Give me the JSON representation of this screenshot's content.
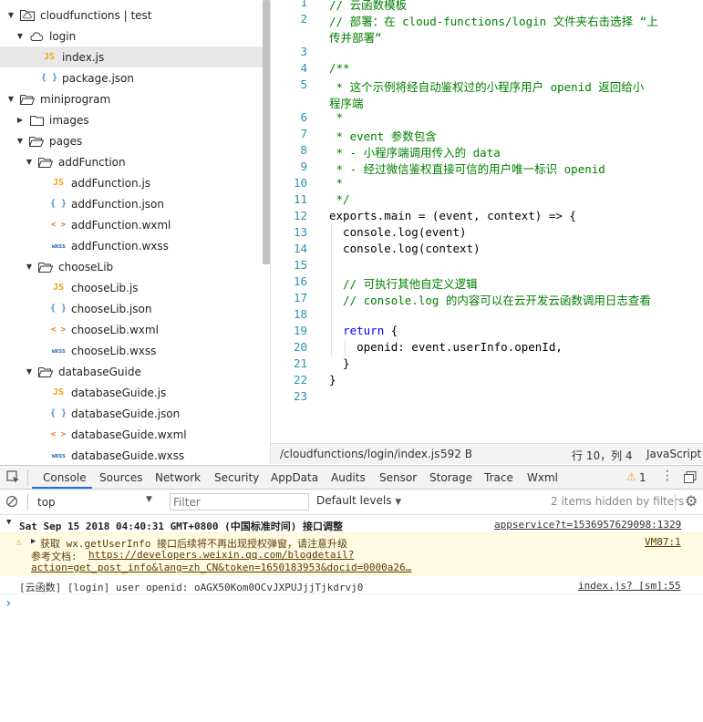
{
  "sidebar": {
    "items": [
      {
        "label": "cloudfunctions | test",
        "level": 0,
        "caret": "down",
        "icon": "cloud-folder-icon"
      },
      {
        "label": "login",
        "level": 1,
        "caret": "down",
        "icon": "cloud-icon"
      },
      {
        "label": "index.js",
        "level": 2,
        "caret": "",
        "icon": "js-file-icon",
        "selected": true
      },
      {
        "label": "package.json",
        "level": 2,
        "caret": "",
        "icon": "json-file-icon"
      },
      {
        "label": "miniprogram",
        "level": 0,
        "caret": "down",
        "icon": "folder-open-icon"
      },
      {
        "label": "images",
        "level": 1,
        "caret": "right",
        "icon": "folder-icon"
      },
      {
        "label": "pages",
        "level": 1,
        "caret": "down",
        "icon": "folder-open-icon"
      },
      {
        "label": "addFunction",
        "level": 2,
        "caret": "down",
        "icon": "folder-open-icon"
      },
      {
        "label": "addFunction.js",
        "level": 3,
        "caret": "",
        "icon": "js-file-icon"
      },
      {
        "label": "addFunction.json",
        "level": 3,
        "caret": "",
        "icon": "json-file-icon"
      },
      {
        "label": "addFunction.wxml",
        "level": 3,
        "caret": "",
        "icon": "wxml-file-icon"
      },
      {
        "label": "addFunction.wxss",
        "level": 3,
        "caret": "",
        "icon": "wxss-file-icon"
      },
      {
        "label": "chooseLib",
        "level": 2,
        "caret": "down",
        "icon": "folder-open-icon"
      },
      {
        "label": "chooseLib.js",
        "level": 3,
        "caret": "",
        "icon": "js-file-icon"
      },
      {
        "label": "chooseLib.json",
        "level": 3,
        "caret": "",
        "icon": "json-file-icon"
      },
      {
        "label": "chooseLib.wxml",
        "level": 3,
        "caret": "",
        "icon": "wxml-file-icon"
      },
      {
        "label": "chooseLib.wxss",
        "level": 3,
        "caret": "",
        "icon": "wxss-file-icon"
      },
      {
        "label": "databaseGuide",
        "level": 2,
        "caret": "down",
        "icon": "folder-open-icon"
      },
      {
        "label": "databaseGuide.js",
        "level": 3,
        "caret": "",
        "icon": "js-file-icon"
      },
      {
        "label": "databaseGuide.json",
        "level": 3,
        "caret": "",
        "icon": "json-file-icon"
      },
      {
        "label": "databaseGuide.wxml",
        "level": 3,
        "caret": "",
        "icon": "wxml-file-icon"
      },
      {
        "label": "databaseGuide.wxss",
        "level": 3,
        "caret": "",
        "icon": "wxss-file-icon"
      }
    ],
    "icon_glyphs": {
      "js": "JS",
      "json": "{ }",
      "wxml": "< >",
      "wxss": "wxss"
    }
  },
  "editor": {
    "lines": [
      {
        "n": "1",
        "text": "// 云函数模板",
        "cls": "c"
      },
      {
        "n": "2",
        "text": "// 部署：在 cloud-functions/login 文件夹右击选择 “上",
        "cls": "c"
      },
      {
        "n": "",
        "text": "传并部署”",
        "cls": "c",
        "wrap": true
      },
      {
        "n": "3",
        "text": "",
        "cls": ""
      },
      {
        "n": "4",
        "text": "/**",
        "cls": "c"
      },
      {
        "n": "5",
        "text": " * 这个示例将经自动鉴权过的小程序用户 openid 返回给小",
        "cls": "c"
      },
      {
        "n": "",
        "text": "程序端",
        "cls": "c",
        "wrap": true
      },
      {
        "n": "6",
        "text": " *",
        "cls": "c"
      },
      {
        "n": "7",
        "text": " * event 参数包含",
        "cls": "c"
      },
      {
        "n": "8",
        "text": " * - 小程序端调用传入的 data",
        "cls": "c"
      },
      {
        "n": "9",
        "text": " * - 经过微信鉴权直接可信的用户唯一标识 openid",
        "cls": "c"
      },
      {
        "n": "10",
        "text": " *",
        "cls": "c"
      },
      {
        "n": "11",
        "text": " */",
        "cls": "c"
      },
      {
        "n": "12",
        "text": "exports.main = (event, context) => {",
        "cls": ""
      },
      {
        "n": "13",
        "text": "  console.log(event)",
        "cls": ""
      },
      {
        "n": "14",
        "text": "  console.log(context)",
        "cls": ""
      },
      {
        "n": "15",
        "text": "",
        "cls": ""
      },
      {
        "n": "16",
        "text": "  // 可执行其他自定义逻辑",
        "cls": "c"
      },
      {
        "n": "17",
        "text": "  // console.log 的内容可以在云开发云函数调用日志查看",
        "cls": "c"
      },
      {
        "n": "18",
        "text": "",
        "cls": ""
      },
      {
        "n": "19",
        "text": "  return {",
        "cls": "kw"
      },
      {
        "n": "20",
        "text": "    openid: event.userInfo.openId,",
        "cls": ""
      },
      {
        "n": "21",
        "text": "  }",
        "cls": ""
      },
      {
        "n": "22",
        "text": "}",
        "cls": ""
      },
      {
        "n": "23",
        "text": "",
        "cls": ""
      }
    ]
  },
  "statusbar": {
    "path": "/cloudfunctions/login/index.js",
    "size": "592 B",
    "position": "行 10，列 4",
    "language": "JavaScript"
  },
  "devtools": {
    "tabs": [
      "Console",
      "Sources",
      "Network",
      "Security",
      "AppData",
      "Audits",
      "Sensor",
      "Storage",
      "Trace",
      "Wxml"
    ],
    "active_tab": "Console",
    "warning_count": "1",
    "context": "top",
    "filter_placeholder": "Filter",
    "levels": "Default levels",
    "hidden_info": "2 items hidden by filters"
  },
  "console": {
    "group_title": "Sat Sep 15 2018 04:40:31 GMT+0800 (中国标准时间) 接口调整",
    "group_link": "appservice?t=1536957629098:1329",
    "warn_line1": "获取 wx.getUserInfo 接口后续将不再出现授权弹窗，请注意升级",
    "warn_link": "VM87:1",
    "warn_line2_label": "参考文档: ",
    "warn_line2_url": "https://developers.weixin.qq.com/blogdetail?",
    "warn_line3_url": "action=get_post_info&lang=zh_CN&token=1650183953&docid=0000a26…",
    "log_text": "[云函数] [login] user openid:  oAGX50Kom0OCvJXPUJjjTjkdrvj0",
    "log_link": "index.js? [sm]:55",
    "prompt": "›"
  },
  "colors": {
    "line_number": "#2b91af",
    "comment": "#008000",
    "keyword": "#0000ff",
    "warn_bg": "#fffbe5",
    "accent": "#1a73e8"
  }
}
